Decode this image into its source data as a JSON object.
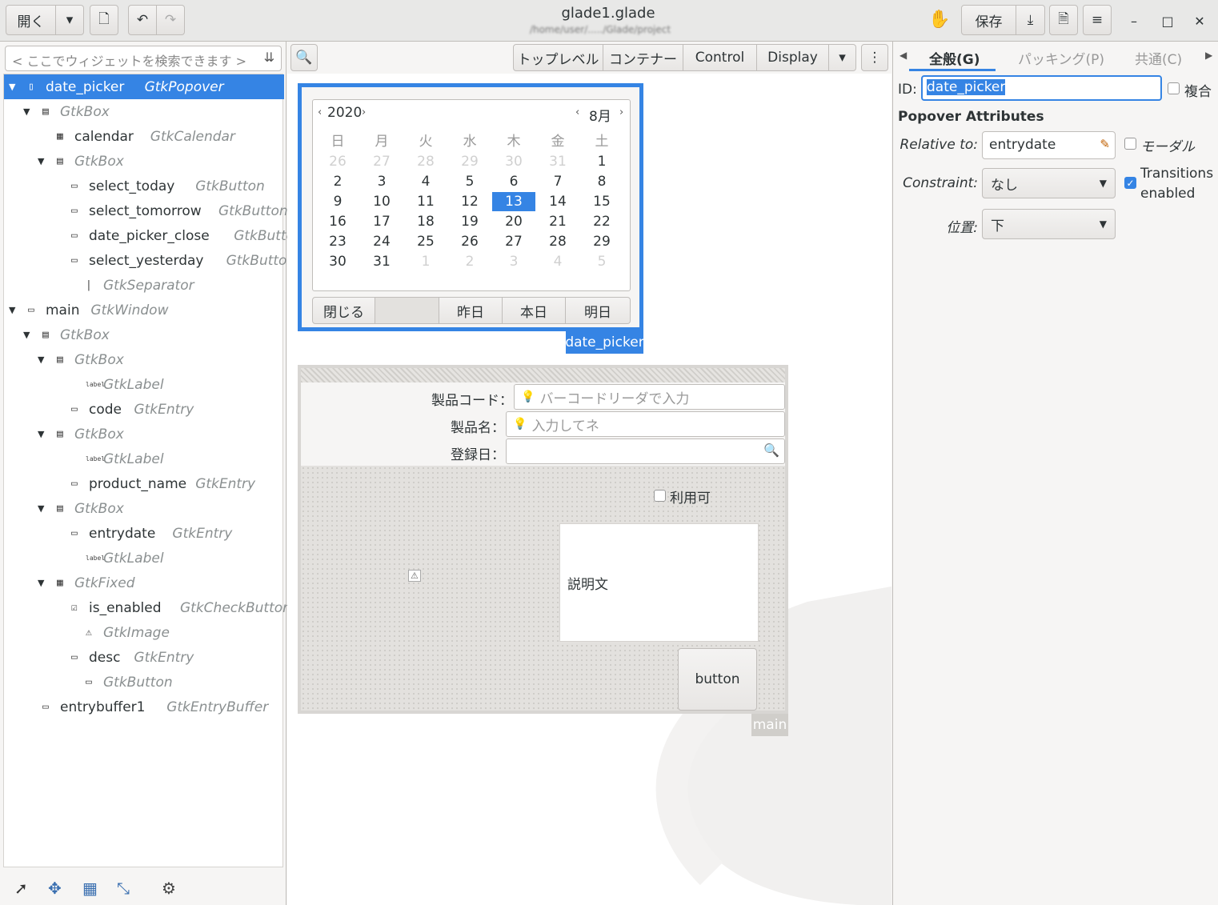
{
  "window": {
    "title": "glade1.glade",
    "subtitle": "/home/user/...../Glade/project",
    "open_label": "開く",
    "save_label": "保存"
  },
  "search": {
    "placeholder": "< ここでウィジェットを検索できます >"
  },
  "tree": [
    {
      "name": "date_picker",
      "cls": "GtkPopover",
      "level": 0,
      "expander": "▼",
      "icon": "▯",
      "selected": true
    },
    {
      "name": "",
      "cls": "GtkBox",
      "level": 1,
      "expander": "▼",
      "icon": "▤"
    },
    {
      "name": "calendar",
      "cls": "GtkCalendar",
      "level": 2,
      "expander": "",
      "icon": "▦"
    },
    {
      "name": "",
      "cls": "GtkBox",
      "level": 2,
      "expander": "▼",
      "icon": "▤"
    },
    {
      "name": "select_today",
      "cls": "GtkButton",
      "level": 3,
      "expander": "",
      "icon": "▭"
    },
    {
      "name": "select_tomorrow",
      "cls": "GtkButton",
      "level": 3,
      "expander": "",
      "icon": "▭"
    },
    {
      "name": "date_picker_close",
      "cls": "GtkButton",
      "level": 3,
      "expander": "",
      "icon": "▭"
    },
    {
      "name": "select_yesterday",
      "cls": "GtkButton",
      "level": 3,
      "expander": "",
      "icon": "▭"
    },
    {
      "name": "",
      "cls": "GtkSeparator",
      "level": 4,
      "expander": "",
      "icon": "|"
    },
    {
      "name": "main",
      "cls": "GtkWindow",
      "level": 0,
      "expander": "▼",
      "icon": "▭"
    },
    {
      "name": "",
      "cls": "GtkBox",
      "level": 1,
      "expander": "▼",
      "icon": "▤"
    },
    {
      "name": "",
      "cls": "GtkBox",
      "level": 2,
      "expander": "▼",
      "icon": "▤"
    },
    {
      "name": "",
      "cls": "GtkLabel",
      "level": 4,
      "expander": "",
      "icon": "label"
    },
    {
      "name": "code",
      "cls": "GtkEntry",
      "level": 3,
      "expander": "",
      "icon": "▭"
    },
    {
      "name": "",
      "cls": "GtkBox",
      "level": 2,
      "expander": "▼",
      "icon": "▤"
    },
    {
      "name": "",
      "cls": "GtkLabel",
      "level": 4,
      "expander": "",
      "icon": "label"
    },
    {
      "name": "product_name",
      "cls": "GtkEntry",
      "level": 3,
      "expander": "",
      "icon": "▭"
    },
    {
      "name": "",
      "cls": "GtkBox",
      "level": 2,
      "expander": "▼",
      "icon": "▤"
    },
    {
      "name": "entrydate",
      "cls": "GtkEntry",
      "level": 3,
      "expander": "",
      "icon": "▭"
    },
    {
      "name": "",
      "cls": "GtkLabel",
      "level": 4,
      "expander": "",
      "icon": "label"
    },
    {
      "name": "",
      "cls": "GtkFixed",
      "level": 2,
      "expander": "▼",
      "icon": "▦"
    },
    {
      "name": "is_enabled",
      "cls": "GtkCheckButton",
      "level": 3,
      "expander": "",
      "icon": "☑"
    },
    {
      "name": "",
      "cls": "GtkImage",
      "level": 4,
      "expander": "",
      "icon": "⚠"
    },
    {
      "name": "desc",
      "cls": "GtkEntry",
      "level": 3,
      "expander": "",
      "icon": "▭"
    },
    {
      "name": "",
      "cls": "GtkButton",
      "level": 4,
      "expander": "",
      "icon": "▭"
    },
    {
      "name": "entrybuffer1",
      "cls": "GtkEntryBuffer",
      "level": 1,
      "expander": "",
      "icon": "▭"
    }
  ],
  "center": {
    "tabs": [
      "トップレベル",
      "コンテナー",
      "Control",
      "Display"
    ]
  },
  "popover": {
    "label": "date_picker",
    "year": "2020",
    "month": "8月",
    "weekdays": [
      "日",
      "月",
      "火",
      "水",
      "木",
      "金",
      "土"
    ],
    "days": [
      [
        "26",
        "27",
        "28",
        "29",
        "30",
        "31",
        "1"
      ],
      [
        "2",
        "3",
        "4",
        "5",
        "6",
        "7",
        "8"
      ],
      [
        "9",
        "10",
        "11",
        "12",
        "13",
        "14",
        "15"
      ],
      [
        "16",
        "17",
        "18",
        "19",
        "20",
        "21",
        "22"
      ],
      [
        "23",
        "24",
        "25",
        "26",
        "27",
        "28",
        "29"
      ],
      [
        "30",
        "31",
        "1",
        "2",
        "3",
        "4",
        "5"
      ]
    ],
    "today": "13",
    "buttons": {
      "close": "閉じる",
      "yesterday": "昨日",
      "today": "本日",
      "tomorrow": "明日"
    }
  },
  "mainwin": {
    "label": "main",
    "code_label": "製品コード：",
    "code_placeholder": "バーコードリーダで入力",
    "name_label": "製品名：",
    "name_placeholder": "入力してネ",
    "date_label": "登録日：",
    "check_label": "利用可",
    "desc_text": "説明文",
    "button_label": "button"
  },
  "right": {
    "tabs": [
      "全般(G)",
      "パッキング(P)",
      "共通(C)"
    ],
    "id_label": "ID:",
    "id_value": "date_picker",
    "composite_label": "複合",
    "section_title": "Popover Attributes",
    "relative_label": "Relative to:",
    "relative_value": "entrydate",
    "modal_label": "モーダル",
    "constraint_label": "Constraint:",
    "constraint_value": "なし",
    "transitions_label_1": "Transitions",
    "transitions_label_2": "enabled",
    "position_label": "位置:",
    "position_value": "下"
  },
  "colors": {
    "accent": "#3584e4"
  }
}
